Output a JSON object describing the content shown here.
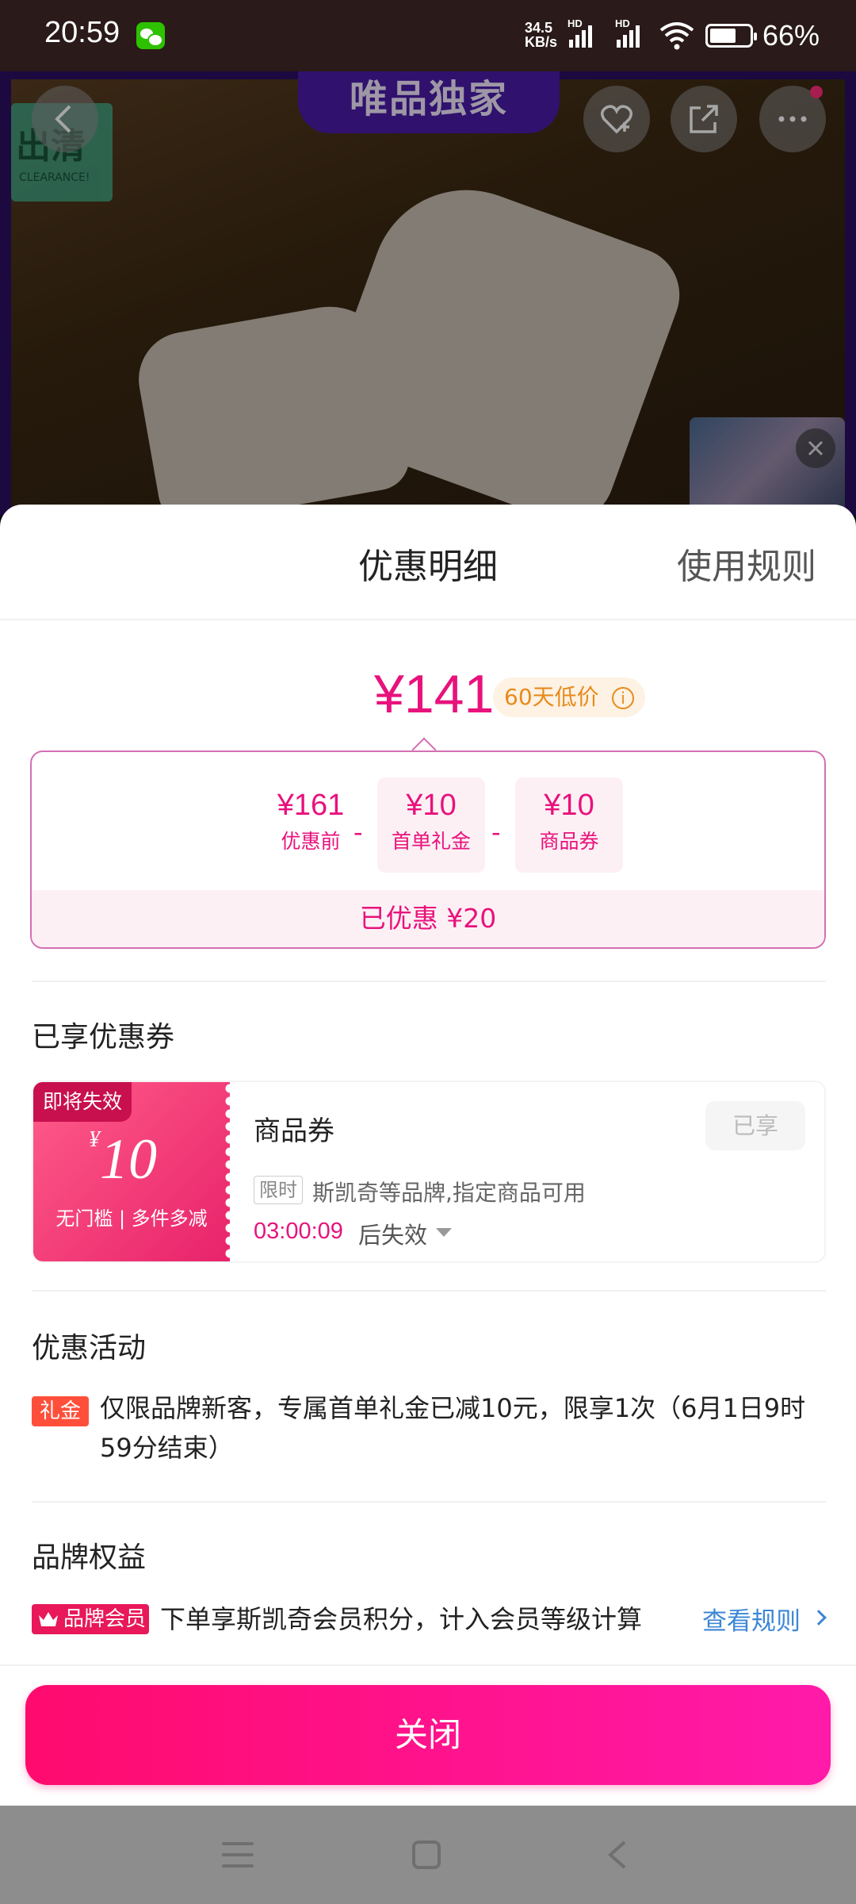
{
  "status_bar": {
    "time": "20:59",
    "net_speed_top": "34.5",
    "net_speed_unit": "KB/s",
    "hd1": "HD",
    "hd2": "HD",
    "battery_percent": "66%",
    "battery_level": 0.66
  },
  "hero": {
    "banner": "唯品独家",
    "clearance_badge": "出清",
    "clearance_sub": "CLEARANCE!",
    "icons": [
      "back-icon",
      "favorite-add-icon",
      "share-icon",
      "more-icon",
      "close-icon"
    ]
  },
  "sheet": {
    "title": "优惠明细",
    "rules_link": "使用规则",
    "final_price": "¥141",
    "low_price_tag": "60天低价",
    "low_price_info_icon": "i",
    "breakdown": {
      "items": [
        {
          "value": "¥161",
          "label": "优惠前"
        },
        {
          "value": "¥10",
          "label": "首单礼金"
        },
        {
          "value": "¥10",
          "label": "商品券"
        }
      ],
      "minus": "-",
      "total": "已优惠 ¥20"
    },
    "coupons_section_title": "已享优惠券",
    "coupon": {
      "badge": "即将失效",
      "currency": "¥",
      "amount": "10",
      "condition": "无门槛 | 多件多减",
      "name": "商品券",
      "status_button": "已享",
      "limit_tag": "限时",
      "description": "斯凯奇等品牌,指定商品可用",
      "countdown": "03:00:09",
      "expire_suffix": "后失效"
    },
    "activity_section_title": "优惠活动",
    "activity": {
      "tag": "礼金",
      "text": "仅限品牌新客，专属首单礼金已减10元，限享1次（6月1日9时59分结束）"
    },
    "brand_section_title": "品牌权益",
    "brand": {
      "tag": "品牌会员",
      "text": "下单享斯凯奇会员积分，计入会员等级计算",
      "link": "查看规则"
    },
    "close_button": "关闭"
  },
  "colors": {
    "accent": "#e8127c",
    "button_gradient_start": "#ff0b6e",
    "button_gradient_end": "#ff1aa9",
    "link": "#3c87d6",
    "low_price": "#e88a1d"
  }
}
